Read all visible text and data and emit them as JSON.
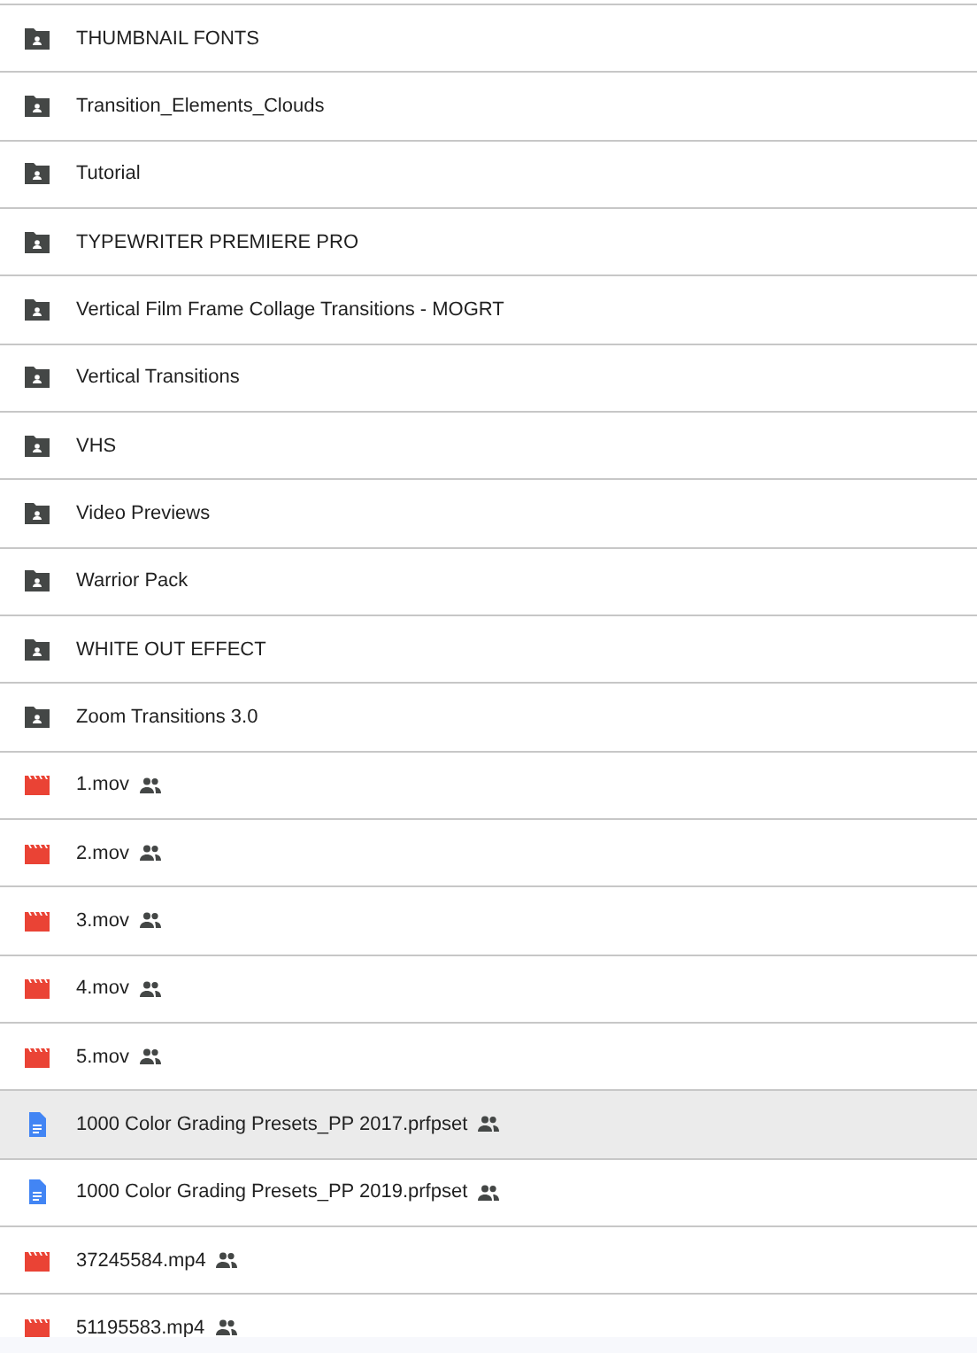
{
  "files": [
    {
      "name": "THUMBNAIL FONTS",
      "kind": "folder",
      "shared": false,
      "selected": false
    },
    {
      "name": "Transition_Elements_Clouds",
      "kind": "folder",
      "shared": false,
      "selected": false
    },
    {
      "name": "Tutorial",
      "kind": "folder",
      "shared": false,
      "selected": false
    },
    {
      "name": "TYPEWRITER PREMIERE PRO",
      "kind": "folder",
      "shared": false,
      "selected": false
    },
    {
      "name": "Vertical Film Frame Collage Transitions - MOGRT",
      "kind": "folder",
      "shared": false,
      "selected": false
    },
    {
      "name": "Vertical Transitions",
      "kind": "folder",
      "shared": false,
      "selected": false
    },
    {
      "name": "VHS",
      "kind": "folder",
      "shared": false,
      "selected": false
    },
    {
      "name": "Video Previews",
      "kind": "folder",
      "shared": false,
      "selected": false
    },
    {
      "name": "Warrior Pack",
      "kind": "folder",
      "shared": false,
      "selected": false
    },
    {
      "name": "WHITE OUT EFFECT",
      "kind": "folder",
      "shared": false,
      "selected": false
    },
    {
      "name": "Zoom Transitions 3.0",
      "kind": "folder",
      "shared": false,
      "selected": false
    },
    {
      "name": "1.mov",
      "kind": "video",
      "shared": true,
      "selected": false
    },
    {
      "name": "2.mov",
      "kind": "video",
      "shared": true,
      "selected": false
    },
    {
      "name": "3.mov",
      "kind": "video",
      "shared": true,
      "selected": false
    },
    {
      "name": "4.mov",
      "kind": "video",
      "shared": true,
      "selected": false
    },
    {
      "name": "5.mov",
      "kind": "video",
      "shared": true,
      "selected": false
    },
    {
      "name": "1000 Color Grading Presets_PP 2017.prfpset",
      "kind": "document",
      "shared": true,
      "selected": true
    },
    {
      "name": "1000 Color Grading Presets_PP 2019.prfpset",
      "kind": "document",
      "shared": true,
      "selected": false
    },
    {
      "name": "37245584.mp4",
      "kind": "video",
      "shared": true,
      "selected": false
    },
    {
      "name": "51195583.mp4",
      "kind": "video",
      "shared": true,
      "selected": false
    }
  ]
}
